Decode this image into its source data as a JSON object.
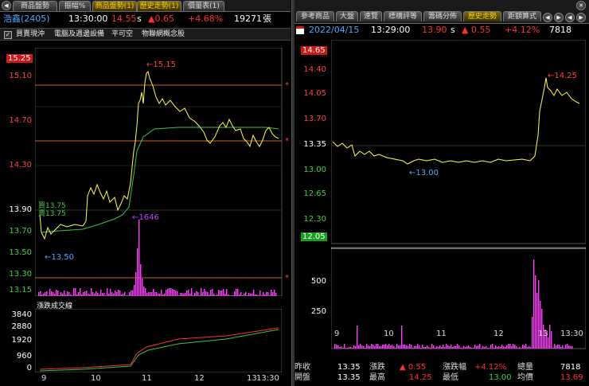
{
  "left_tabs": [
    "商品盤勢",
    "振幅%",
    "商品盤勢(1)",
    "歷史走勢(1)",
    "價量表(1)"
  ],
  "right_tabs": [
    "參考商品",
    "大盤",
    "速覽",
    "標構評等",
    "籌碼分佈",
    "歷史走勢",
    "距額算式"
  ],
  "left_quote": {
    "symbol": "浩鑫(2405)",
    "time": "13:30:00",
    "price": "14.55",
    "flag": "s",
    "change": "▲0.65",
    "pct": "+4.68%",
    "volume": "19271",
    "volume_unit": "張"
  },
  "concept_bar": [
    "買賣現沖",
    "電腦及週邊設備",
    "平可空",
    "物聯網概念股"
  ],
  "right_quote": {
    "date": "2022/04/15",
    "time": "13:29:00",
    "price": "13.90",
    "flag": "s",
    "change": "▲ 0.55",
    "pct": "+4.12%",
    "volume": "7818"
  },
  "left_chart": {
    "y_labels": [
      "15.25",
      "15.10",
      "14.70",
      "14.30",
      "13.90",
      "13.70",
      "13.50",
      "13.30",
      "13.15"
    ],
    "annotations": {
      "high": "←15.15",
      "low": "←13.50",
      "vol_peak": "←1646",
      "buy": "買13.75",
      "sell": "賣13.75"
    },
    "sub_title": "漲跌成交線",
    "sub_y_labels": [
      "3840",
      "2880",
      "1920",
      "960",
      "0"
    ],
    "x_labels": [
      "9",
      "10",
      "11",
      "12",
      "13",
      "13:30"
    ]
  },
  "right_chart": {
    "y_labels": [
      "14.65",
      "14.40",
      "14.05",
      "13.70",
      "13.35",
      "13.00",
      "12.65",
      "12.30",
      "12.05"
    ],
    "annotations": {
      "high": "←14.25",
      "low": "←13.00"
    },
    "vol_y_labels": [
      "500",
      "250"
    ],
    "x_labels": [
      "9",
      "10",
      "11",
      "12",
      "13",
      "13:30"
    ]
  },
  "footer": {
    "row1": {
      "l1": "昨收",
      "v1": "13.35",
      "l2": "漲跌",
      "v2": "▲ 0.55",
      "l3": "漲跌幅",
      "v3": "+4.12%",
      "l4": "總量",
      "v4": "7818"
    },
    "row2": {
      "l1": "開盤",
      "v1": "13.35",
      "l2": "最高",
      "v2": "14.25",
      "l3": "最低",
      "v3": "13.00",
      "l4": "均價",
      "v4": "13.69"
    }
  },
  "colors": {
    "up": "#ff3030",
    "price_line": "#ffff40",
    "avg_line": "#40c040",
    "volume": "#ff40ff",
    "ref": "#c86428"
  }
}
